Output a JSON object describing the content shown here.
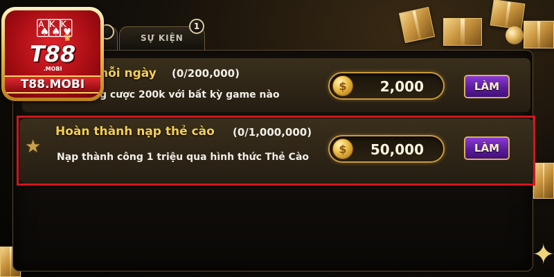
{
  "logo": {
    "brand": "T88",
    "sub": ".MOBI",
    "ribbon": "T88.MOBI",
    "cards_icon": "playing-cards-icon",
    "crown_icon": "crown-icon"
  },
  "tabs": {
    "badge_left": "",
    "event_label": "SỰ KIỆN",
    "event_badge": "1"
  },
  "tasks": [
    {
      "title": "hỗi ngày",
      "progress": "(0/200,000)",
      "description": "g cược 200k với bất kỳ game nào",
      "reward": "2,000",
      "action": "LÀM",
      "coin_symbol": "$"
    },
    {
      "title": "Hoàn thành nạp thẻ cào",
      "progress": "(0/1,000,000)",
      "description": "Nạp thành công 1 triệu qua hình thức Thẻ Cào",
      "reward": "50,000",
      "action": "LÀM",
      "coin_symbol": "$",
      "marker_icon": "star-icon"
    }
  ],
  "colors": {
    "accent_gold": "#f4cf55",
    "button_purple": "#6a24b2",
    "highlight_red": "#d2161e"
  }
}
